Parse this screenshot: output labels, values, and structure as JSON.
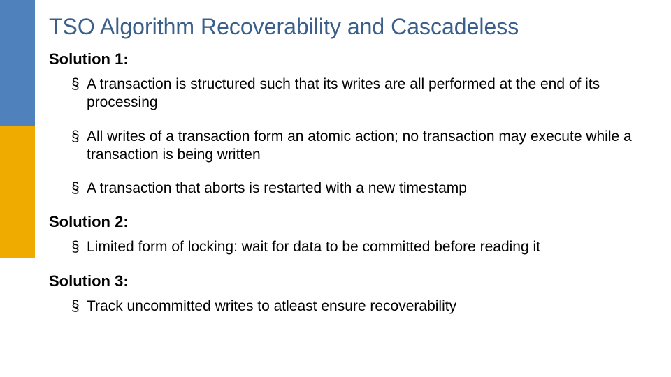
{
  "title": "TSO Algorithm Recoverability and Cascadeless",
  "solutions": [
    {
      "heading": "Solution 1:",
      "bullets": [
        "A transaction is structured such that its writes are all performed at the end of its processing",
        "All writes of a transaction form an atomic action; no transaction may execute while a transaction is being written",
        "A transaction that aborts is restarted with a new timestamp"
      ]
    },
    {
      "heading": "Solution 2:",
      "bullets": [
        "Limited form of locking: wait for data to be committed before reading it"
      ]
    },
    {
      "heading": "Solution 3:",
      "bullets": [
        "Track uncommitted writes to atleast ensure recoverability"
      ]
    }
  ]
}
